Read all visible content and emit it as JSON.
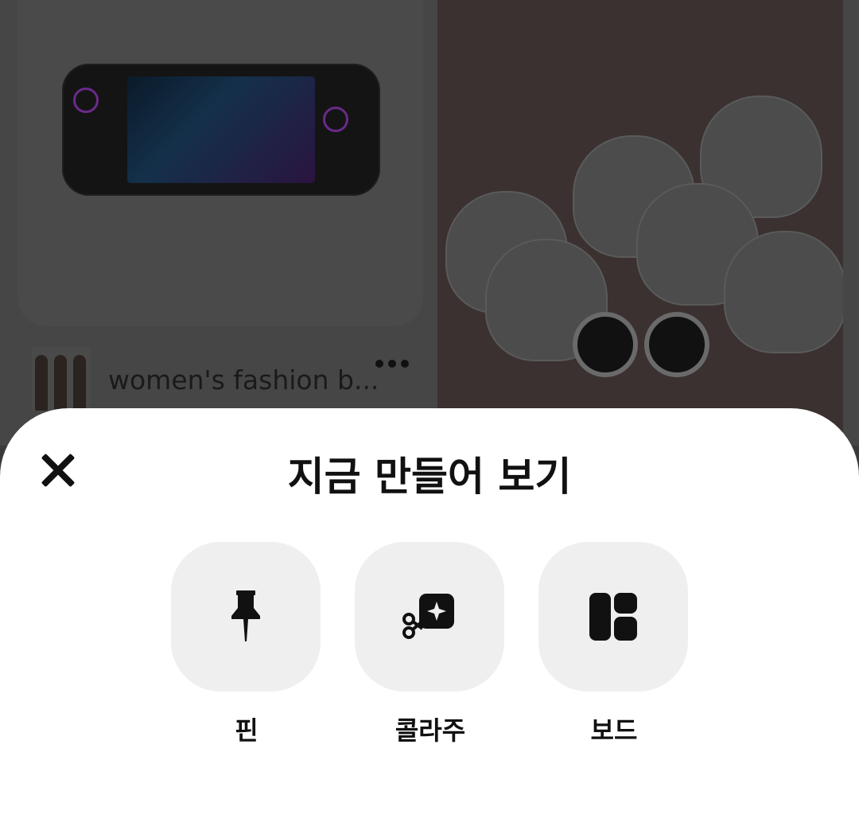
{
  "background_feed": {
    "board_name": "women's fashion b...",
    "more_icon": "more-icon",
    "avatar_icon": "board-avatar"
  },
  "sheet": {
    "title": "지금 만들어 보기",
    "close_icon": "close-icon",
    "options": [
      {
        "label": "핀",
        "icon": "pushpin-icon"
      },
      {
        "label": "콜라주",
        "icon": "scissors-sparkle-icon"
      },
      {
        "label": "보드",
        "icon": "board-grid-icon"
      }
    ]
  },
  "colors": {
    "overlay": "#464646",
    "sheet_bg": "#ffffff",
    "tile_bg": "#efefef",
    "text": "#111111"
  }
}
